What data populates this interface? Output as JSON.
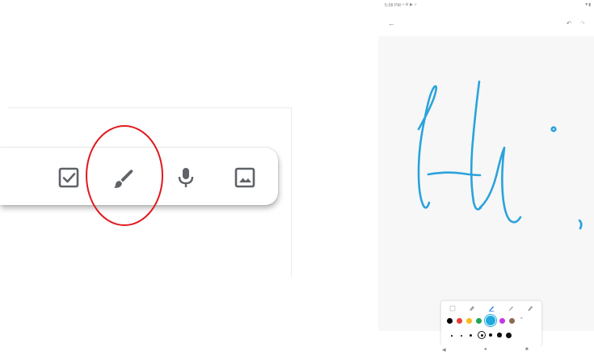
{
  "toolbar": {
    "icons": [
      "checkbox-icon",
      "brush-icon",
      "microphone-icon",
      "image-icon"
    ],
    "highlighted_item": "brush-icon",
    "highlight_color": "#e0191e",
    "icon_color": "#5f6368"
  },
  "tablet": {
    "status_bar": {
      "time": "5:08 PM",
      "notif_icons": "▪ ⚙ ▶ ✓",
      "right_icons": "▼▮"
    },
    "app_bar": {
      "back_glyph": "←",
      "undo_glyph": "↶",
      "redo_glyph": "↷"
    },
    "canvas": {
      "ink_color": "#2aa3dc"
    },
    "pen_panel": {
      "tools": [
        "select-tool-icon",
        "eraser-tool-icon",
        "pen-tool-icon",
        "marker-tool-icon",
        "highlighter-tool-icon"
      ],
      "selected_tool": "pen-tool-icon",
      "colors": [
        "#000000",
        "#e9403a",
        "#fbbb1e",
        "#1fa655",
        "#1fa9df",
        "#c438e2",
        "#8b6b55"
      ],
      "selected_color": "#1fa9df",
      "chevron_glyph": "^",
      "sizes": 7,
      "selected_size": 3
    },
    "nav_bar": {
      "back": "◀",
      "home": "●",
      "recents": "■"
    }
  }
}
